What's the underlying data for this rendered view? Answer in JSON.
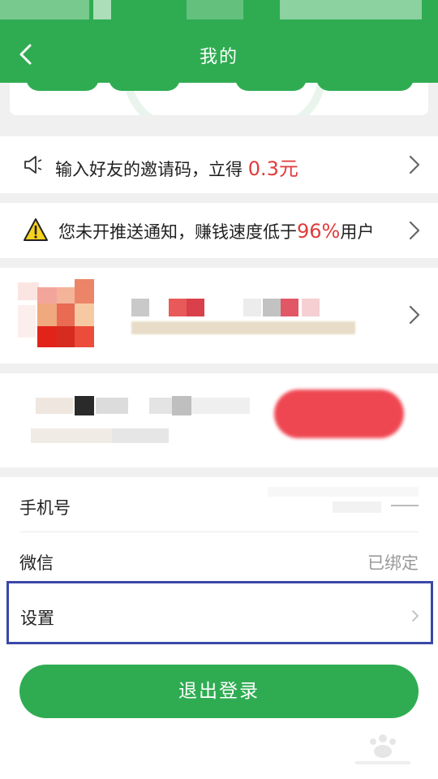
{
  "header": {
    "title": "我的"
  },
  "invite": {
    "text_prefix": "输入好友的邀请码，立得 ",
    "amount": "0.3元"
  },
  "notify": {
    "text_prefix": "您未开推送通知，赚钱速度低于",
    "percent": "96%",
    "text_suffix": "用户"
  },
  "account": {
    "phone_label": "手机号",
    "wechat_label": "微信",
    "wechat_status": "已绑定",
    "settings_label": "设置"
  },
  "logout_label": "退出登录",
  "colors": {
    "primary": "#2fac52",
    "accent_red": "#e23b3b",
    "highlight_border": "#3a48a8"
  }
}
